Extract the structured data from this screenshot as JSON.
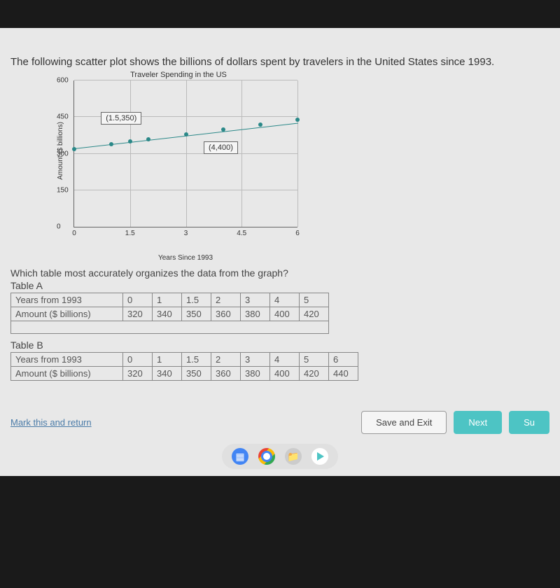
{
  "question": "The following scatter plot shows the billions of dollars spent by travelers in the United States since 1993.",
  "chart_data": {
    "type": "scatter",
    "title": "Traveler Spending in the US",
    "xlabel": "Years Since 1993",
    "ylabel": "Amount\n($\nbillions)",
    "xlim": [
      0,
      6
    ],
    "ylim": [
      0,
      600
    ],
    "xticks": [
      0,
      1.5,
      3,
      4.5,
      6
    ],
    "yticks": [
      0,
      150,
      300,
      450,
      600
    ],
    "x": [
      0,
      1,
      1.5,
      2,
      3,
      4,
      5,
      6
    ],
    "y": [
      320,
      340,
      350,
      360,
      380,
      400,
      420,
      440
    ],
    "annotations": [
      {
        "text": "(1.5,350)",
        "x": 1.5,
        "y": 450
      },
      {
        "text": "(4,400)",
        "x": 4,
        "y": 320
      }
    ]
  },
  "sub_question": "Which table most accurately organizes the data from the graph?",
  "tables": {
    "a": {
      "label": "Table A",
      "row1_label": "Years from 1993",
      "row1": [
        "0",
        "1",
        "1.5",
        "2",
        "3",
        "4",
        "5"
      ],
      "row2_label": "Amount ($ billions)",
      "row2": [
        "320",
        "340",
        "350",
        "360",
        "380",
        "400",
        "420"
      ]
    },
    "b": {
      "label": "Table B",
      "row1_label": "Years from 1993",
      "row1": [
        "0",
        "1",
        "1.5",
        "2",
        "3",
        "4",
        "5",
        "6"
      ],
      "row2_label": "Amount ($ billions)",
      "row2": [
        "320",
        "340",
        "350",
        "360",
        "380",
        "400",
        "420",
        "440"
      ]
    }
  },
  "buttons": {
    "mark": "Mark this and return",
    "save": "Save and Exit",
    "next": "Next",
    "submit": "Su"
  }
}
